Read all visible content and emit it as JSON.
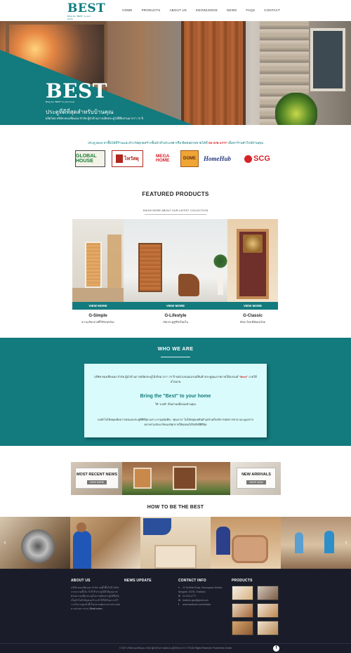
{
  "header": {
    "logo_text": "BEST",
    "logo_tagline": "Bring the \"BEST\" to your home",
    "nav": [
      "HOME",
      "PRODUCTS",
      "ABOUT US",
      "KNOWLEDGE",
      "NEWS",
      "FAQS",
      "CONTACT"
    ]
  },
  "hero": {
    "logo_text": "BEST",
    "logo_tagline": "Bring the \"BEST\" to your home",
    "title": "ประตูที่ดีที่สุดสำหรับบ้านคุณ",
    "subtitle": "ผลิตโดย บริษัท ทองเชียงเฮง จำกัด ผู้นำด้านการผลิตประตูไม้ที่สืบสานมากว่า 70 ปี"
  },
  "partners": {
    "text": "ประตู Best หาซื้อได้ที่ร้านและห้างวัสดุก่อสร้างชั้นนำทั่วประเทศ หรือ ติดต่อฝ่ายขายได้ที่",
    "phone": "02-376-1777",
    "text_after": "เพื่อหาร้านค้าใกล้บ้านคุณ",
    "logos": [
      "GLOBAL HOUSE",
      "ไทวัสดุ",
      "MEGA HOME",
      "DOME",
      "HomeHub",
      "SCG"
    ]
  },
  "featured": {
    "title": "FEATURED PRODUCTS",
    "subtitle": "KNOW MORE ABOUT OUR LATEST COLLECTION",
    "products": [
      {
        "name": "G-Simple",
        "desc": "ความเรียบง่ายที่ใช้กับทุกห้อง",
        "button": "VIEW MORE"
      },
      {
        "name": "G-Lifestyle",
        "desc": "เปิดประตูสู่ชีวิตใหม่ใน",
        "button": "VIEW MORE"
      },
      {
        "name": "G-Classic",
        "desc": "ศิลปะไทย ฝีมือคนไทย",
        "button": "VIEW MORE"
      }
    ]
  },
  "who": {
    "title": "WHO WE ARE",
    "paragraph1": "บริษัท ทองเชียงเฮง จำกัด ผู้นำด้านการผลิตประตูไม้จริงมากว่า 70 ปี ขอนำเสนอแบรนด์สินค้าประตูคุณภาพภายใต้แบรนด์",
    "paragraph1_brand": "\"Best\"",
    "paragraph1_tail": "ภายใต้สโลแกน",
    "heading": "Bring the \"Best\" to your home",
    "paragraph2": "ให้ \"เบสท์\" เป็นส่วนหนึ่งของบ้านคุณ",
    "paragraph3": "เบสท์ ไม่ได้หยุดเพียงการส่งมอบประตูที่ดีที่สุด เพราะเรามุ่งมั่นที่จะ \"คุณภาพ\" ไม่ได้หยุดแค่สินค้าแต่รวมถึงบริการหลังการขาย และดูแลการตลาดร่วมกับพาร์ทเนอร์ทุกรายให้ทุกคนได้รับสิ่งที่ดีที่สุด"
  },
  "strip": {
    "news_title": "MOST RECENT NEWS",
    "news_button": "VIEW MORE",
    "arrivals_title": "NEW ARRIVALS",
    "arrivals_button": "SHOP NOW"
  },
  "how": {
    "title": "HOW TO BE THE BEST",
    "prev_icon": "‹",
    "next_icon": "›"
  },
  "footer": {
    "about_title": "ABOUT US",
    "about_text": "บริษัท ทองเชียงเฮง จำกัด ก่อตั้งขึ้นในปี 2494 จากความตั้งใจ 70 ปี ที่ ประตูไม้ดี มีคุณภาพ ด้วยความเชี่ยวชาญในการผลิตประตูไม้ซึ่งถือเป็นหัวใจสำคัญของบ้าน ทำให้ได้รับความไว้วางใจจากลูกค้าทั้งในประเทศและต่างประเทศ มาอย่างยาวนาน",
    "about_more": "Read more...",
    "news_title": "NEWS UPDATE",
    "contact_title": "CONTACT INFO",
    "contact": [
      "22 Serithai Road, Kannayaow District, Bangkok 10230, Thailand",
      "02-376-1777",
      "bestinfo.gss@gmail.com",
      "www.facebook.com/bestbe"
    ],
    "products_title": "PRODUCTS",
    "copyright": "© 2017 บริษัท ทองเชียงเฮง จำกัด ผู้นำด้านการผลิตประตูไม้จริงมากว่า 70 ปี All Rights Reserved. Powered by Ocean",
    "facebook": "f"
  }
}
